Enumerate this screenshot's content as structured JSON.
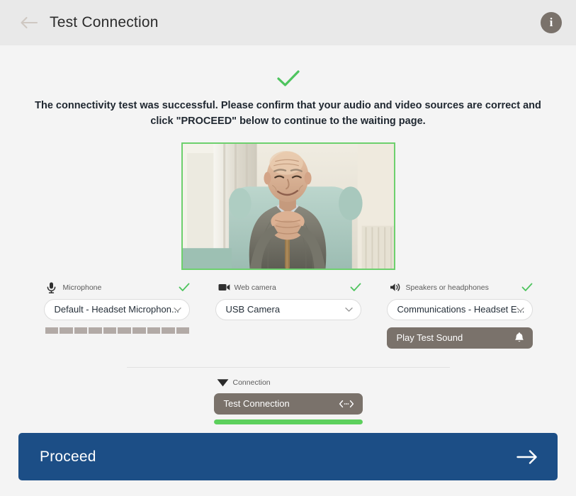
{
  "header": {
    "back_icon": "arrow-left-icon",
    "title": "Test Connection",
    "info_icon": "info-icon",
    "info_label": "i"
  },
  "status": {
    "check_icon": "check-icon",
    "message": "The connectivity test was successful. Please confirm that your audio and video sources are correct and click \"PROCEED\" below to continue to the waiting page."
  },
  "video_preview": {
    "border_color": "#6dd06d",
    "description": "Elderly man smiling, resting hands on a walking cane in a living room"
  },
  "devices": [
    {
      "key": "microphone",
      "icon": "microphone-icon",
      "label": "Microphone",
      "status_icon": "check-icon",
      "status_ok": true,
      "selected": "Default - Headset Microphon...",
      "caret_icon": "chevron-down-icon"
    },
    {
      "key": "webcam",
      "icon": "video-camera-icon",
      "label": "Web camera",
      "status_icon": "check-icon",
      "status_ok": true,
      "selected": "USB Camera",
      "caret_icon": "chevron-down-icon"
    },
    {
      "key": "speakers",
      "icon": "speaker-icon",
      "label": "Speakers or headphones",
      "status_icon": "check-icon",
      "status_ok": true,
      "selected": "Communications - Headset E...",
      "caret_icon": "chevron-down-icon"
    }
  ],
  "mic_meter": {
    "segments": 10,
    "active": 0,
    "inactive_color": "#b2aaa6"
  },
  "play_test_sound": {
    "label": "Play Test Sound",
    "icon": "bell-icon"
  },
  "connection": {
    "icon": "wifi-icon",
    "label": "Connection",
    "button_label": "Test Connection",
    "button_icon": "bidirectional-arrow-icon",
    "progress_percent": 100,
    "progress_color": "#5cd05c"
  },
  "proceed": {
    "label": "Proceed",
    "icon": "arrow-right-icon",
    "color": "#1c4e86"
  },
  "colors": {
    "page_bg": "#f4f4f4",
    "header_bg": "#e9e9e9",
    "accent_green": "#5cd05c",
    "brown_gray": "#7a726b",
    "brand_blue": "#1c4e86"
  }
}
